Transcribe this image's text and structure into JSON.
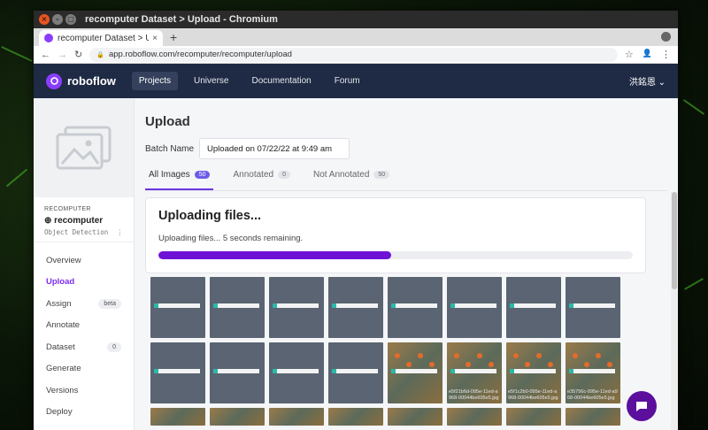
{
  "window": {
    "title": "recomputer Dataset > Upload - Chromium",
    "close_glyph": "×",
    "min_glyph": "–",
    "max_glyph": "□"
  },
  "browser": {
    "tab_title": "recomputer Dataset > Upl",
    "tab_close": "×",
    "new_tab": "+",
    "url": "app.roboflow.com/recomputer/recomputer/upload",
    "back": "←",
    "forward": "→",
    "reload": "↻",
    "lock": "🔒",
    "star": "☆",
    "profile": "👤",
    "menu": "⋮"
  },
  "navbar": {
    "brand": "roboflow",
    "links": [
      "Projects",
      "Universe",
      "Documentation",
      "Forum"
    ],
    "active_index": 0,
    "user": "洪銘恩",
    "user_caret": "⌄"
  },
  "sidebar": {
    "org": "RECOMPUTER",
    "project_name": "recomputer",
    "project_type": "Object Detection",
    "kebab": "⋮",
    "items": [
      {
        "label": "Overview",
        "badge": ""
      },
      {
        "label": "Upload",
        "badge": ""
      },
      {
        "label": "Assign",
        "badge": "beta"
      },
      {
        "label": "Annotate",
        "badge": ""
      },
      {
        "label": "Dataset",
        "badge": "0"
      },
      {
        "label": "Generate",
        "badge": ""
      },
      {
        "label": "Versions",
        "badge": ""
      },
      {
        "label": "Deploy",
        "badge": ""
      }
    ],
    "active_index": 1
  },
  "main": {
    "title": "Upload",
    "batch_label": "Batch Name",
    "batch_value": "Uploaded on 07/22/22 at 9:49 am",
    "tabs": [
      {
        "label": "All Images",
        "count": "50"
      },
      {
        "label": "Annotated",
        "count": "0"
      },
      {
        "label": "Not Annotated",
        "count": "50"
      }
    ],
    "upload_card": {
      "title": "Uploading files...",
      "subtitle": "Uploading files... 5 seconds remaining.",
      "progress": 0.49
    },
    "thumb_captions": [
      "",
      "",
      "",
      "",
      "",
      "",
      "",
      "",
      "",
      "",
      "",
      "",
      "",
      "e5f21b6d-095e-11ed-a968-00044be605e5.jpg",
      "e5f1c2b0-095e-11ed-a968-00044be605e5.jpg",
      "e35756c-095e-11ed-a968-00044be605e5.jpg"
    ]
  },
  "colors": {
    "accent": "#6e12d6",
    "navbar": "#1f2a44",
    "active_link": "#7b2cf0"
  }
}
